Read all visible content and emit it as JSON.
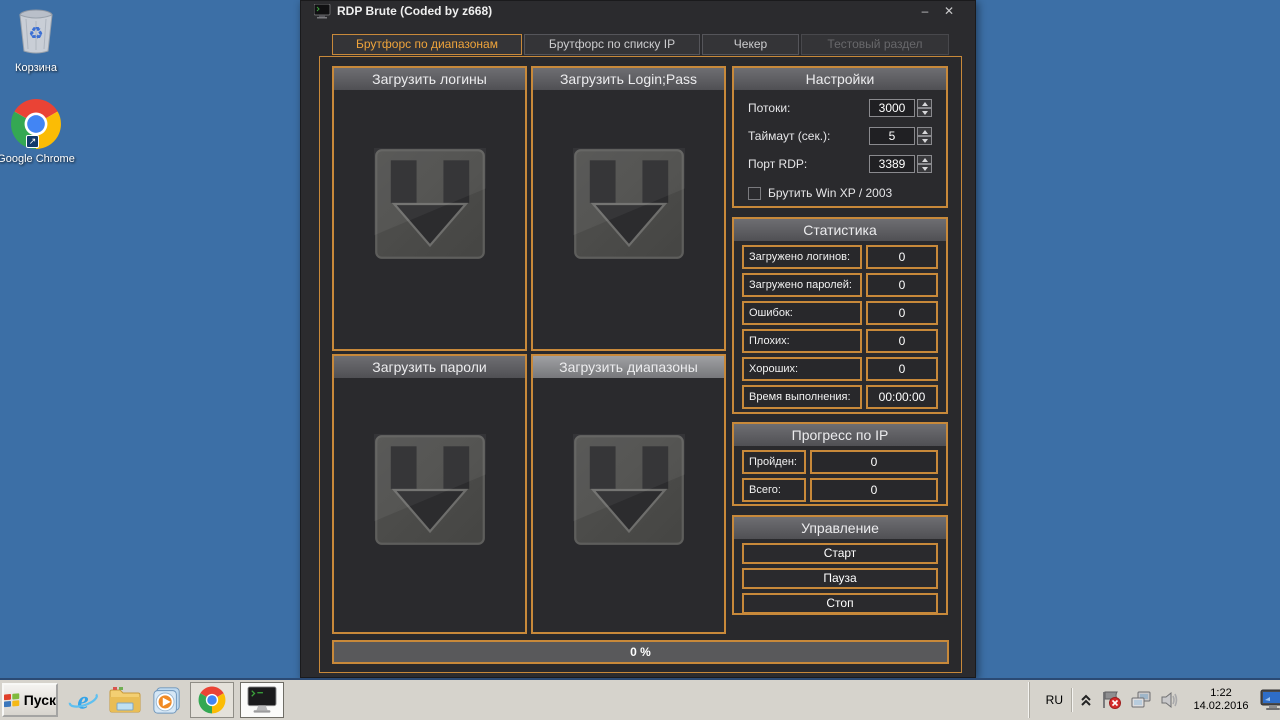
{
  "desktop": {
    "icons": [
      {
        "label": "Корзина"
      },
      {
        "label": "Google Chrome"
      }
    ]
  },
  "window": {
    "title": "RDP Brute (Coded by z668)",
    "minimize_glyph": "–",
    "close_glyph": "✕",
    "tabs": [
      {
        "label": "Брутфорс по диапазонам",
        "state": "active"
      },
      {
        "label": "Брутфорс по списку IP",
        "state": "normal"
      },
      {
        "label": "Чекер",
        "state": "normal"
      },
      {
        "label": "Тестовый раздел",
        "state": "disabled"
      }
    ],
    "load_panels": [
      {
        "title": "Загрузить логины"
      },
      {
        "title": "Загрузить Login;Pass"
      },
      {
        "title": "Загрузить пароли"
      },
      {
        "title": "Загрузить диапазоны"
      }
    ],
    "settings": {
      "title": "Настройки",
      "fields": [
        {
          "label": "Потоки:",
          "value": "3000"
        },
        {
          "label": "Таймаут (сек.):",
          "value": "5"
        },
        {
          "label": "Порт RDP:",
          "value": "3389"
        }
      ],
      "checkbox": {
        "label": "Брутить Win XP / 2003",
        "checked": false
      }
    },
    "statistics": {
      "title": "Статистика",
      "rows": [
        {
          "label": "Загружено логинов:",
          "value": "0"
        },
        {
          "label": "Загружено паролей:",
          "value": "0"
        },
        {
          "label": "Ошибок:",
          "value": "0"
        },
        {
          "label": "Плохих:",
          "value": "0"
        },
        {
          "label": "Хороших:",
          "value": "0"
        },
        {
          "label": "Время выполнения:",
          "value": "00:00:00"
        }
      ]
    },
    "ip_progress": {
      "title": "Прогресс по IP",
      "rows": [
        {
          "label": "Пройден:",
          "value": "0"
        },
        {
          "label": "Всего:",
          "value": "0"
        }
      ]
    },
    "controls": {
      "title": "Управление",
      "buttons": [
        {
          "label": "Старт"
        },
        {
          "label": "Пауза"
        },
        {
          "label": "Стоп"
        }
      ]
    },
    "progress_bar": {
      "value": "0 %"
    }
  },
  "taskbar": {
    "start_label": "Пуск",
    "tray": {
      "language": "RU",
      "time": "1:22",
      "date": "14.02.2016"
    }
  },
  "icons": {
    "recycle_glyph": "♻",
    "shortcut_arrow": "↗"
  },
  "colors": {
    "accent_orange": "#C8893A",
    "active_tab_text": "#EFA43B",
    "desktop_blue": "#3C6FA6",
    "window_bg": "#2B2B2E",
    "taskbar_bg": "#D6D3CC"
  }
}
